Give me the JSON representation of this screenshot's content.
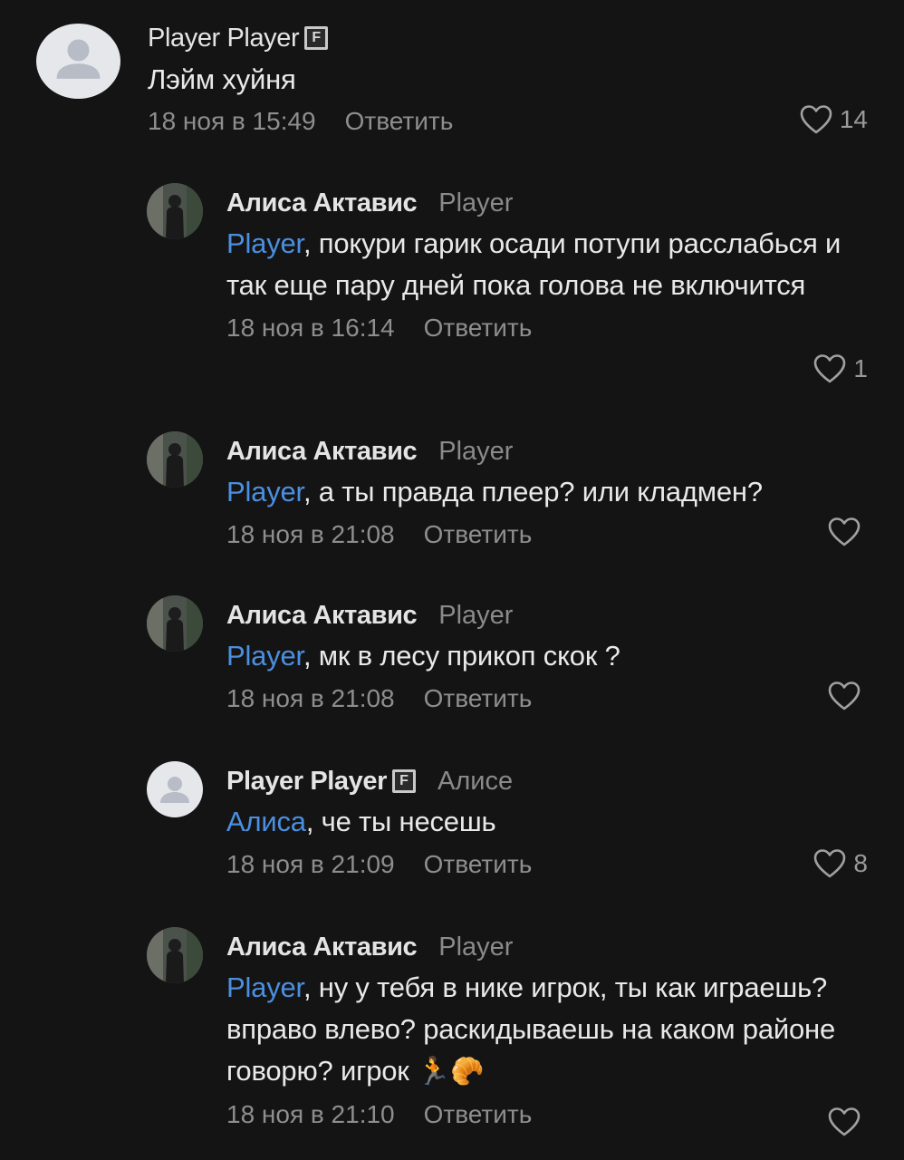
{
  "comments": [
    {
      "author": "Player Player",
      "badge": "F",
      "reply_to": "",
      "mention": "",
      "mention_suffix": "",
      "text": "Лэйм хуйня",
      "date": "18 ноя в 15:49",
      "reply_label": "Ответить",
      "likes": "14",
      "avatar": "default-user-icon"
    },
    {
      "author": "Алиса Актавис",
      "reply_to": "Player",
      "mention": "Player",
      "text": ", покури гарик осади потупи расслабься и так еще пару дней пока голова не включится",
      "date": "18 ноя в 16:14",
      "reply_label": "Ответить",
      "likes": "1",
      "avatar": "photo"
    },
    {
      "author": "Алиса Актавис",
      "reply_to": "Player",
      "mention": "Player",
      "text": ", а ты правда плеер? или кладмен?",
      "date": "18 ноя в 21:08",
      "reply_label": "Ответить",
      "likes": "",
      "avatar": "photo"
    },
    {
      "author": "Алиса Актавис",
      "reply_to": "Player",
      "mention": "Player",
      "text": ", мк в лесу прикоп скок ?",
      "date": "18 ноя в 21:08",
      "reply_label": "Ответить",
      "likes": "",
      "avatar": "photo"
    },
    {
      "author": "Player Player",
      "badge": "F",
      "reply_to": "Алисе",
      "mention": "Алиса",
      "text": ", че ты несешь",
      "date": "18 ноя в 21:09",
      "reply_label": "Ответить",
      "likes": "8",
      "avatar": "default-user-icon"
    },
    {
      "author": "Алиса Актавис",
      "reply_to": "Player",
      "mention": "Player",
      "text": ", ну у тебя в нике игрок, ты как играешь? вправо влево? раскидываешь на каком районе говорю? игрок ",
      "emojis": "🏃🥐",
      "date": "18 ноя в 21:10",
      "reply_label": "Ответить",
      "likes": "",
      "avatar": "photo"
    }
  ],
  "colors": {
    "background": "#141414",
    "mention": "#4b8fe0",
    "meta": "#8e8e8e"
  }
}
